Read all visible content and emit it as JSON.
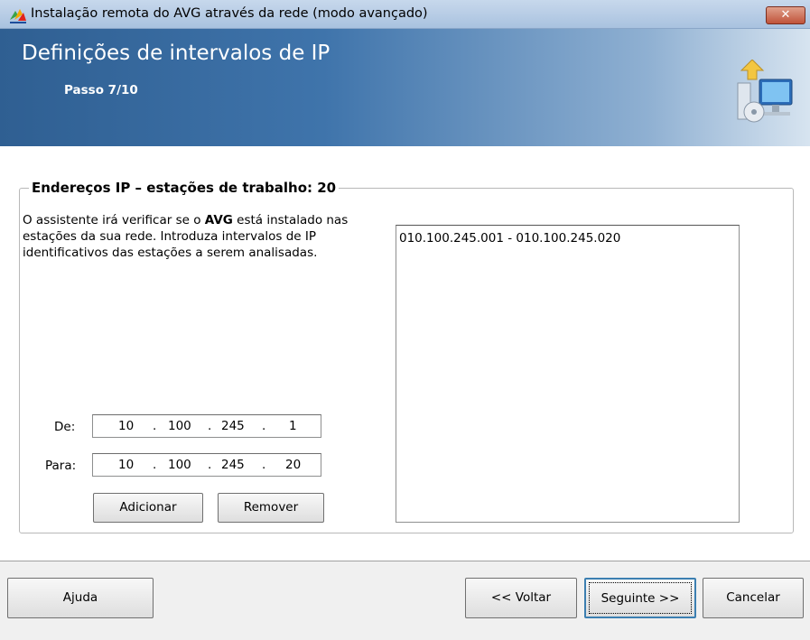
{
  "window": {
    "title": "Instalação remota do AVG através da rede (modo avançado)",
    "close_label": "✕"
  },
  "header": {
    "title": "Definições de intervalos de IP",
    "step": "Passo 7/10"
  },
  "group": {
    "legend": "Endereços IP – estações de trabalho: 20",
    "description_part1": "O assistente irá verificar se o ",
    "description_brand": "AVG",
    "description_part2": " está instalado nas estações da sua rede. Introduza intervalos de IP identificativos das estações a serem analisadas."
  },
  "from": {
    "label": "De:",
    "octets": [
      "10",
      "100",
      "245",
      "1"
    ]
  },
  "to": {
    "label": "Para:",
    "octets": [
      "10",
      "100",
      "245",
      "20"
    ]
  },
  "buttons": {
    "add": "Adicionar",
    "remove": "Remover"
  },
  "ip_ranges": [
    "010.100.245.001 - 010.100.245.020"
  ],
  "footer": {
    "help": "Ajuda",
    "back": "<< Voltar",
    "next": "Seguinte >>",
    "cancel": "Cancelar"
  },
  "colors": {
    "banner_dark": "#2f5f92",
    "titlebar": "#b9cde6",
    "close": "#c0533a"
  }
}
